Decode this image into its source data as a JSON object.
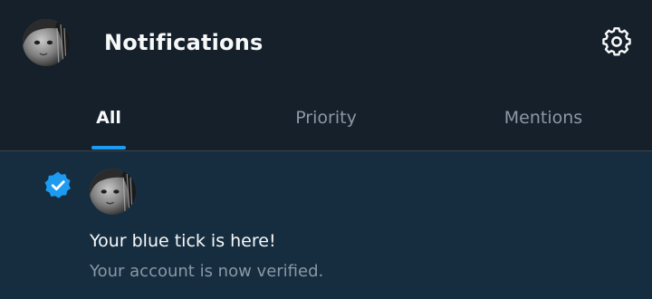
{
  "header": {
    "title": "Notifications",
    "avatar_icon": "profile-avatar",
    "settings_icon": "gear-icon"
  },
  "tabs": [
    {
      "label": "All",
      "active": true
    },
    {
      "label": "Priority",
      "active": false
    },
    {
      "label": "Mentions",
      "active": false
    }
  ],
  "notifications": [
    {
      "icon": "verified-badge-icon",
      "title": "Your blue tick is here!",
      "body": "Your account is now verified."
    }
  ],
  "colors": {
    "background": "#15202b",
    "notification_background": "#162d40",
    "accent": "#1d9bf0",
    "text_primary": "#f7f9f9",
    "text_secondary": "#8b98a5",
    "divider": "#38444d"
  }
}
